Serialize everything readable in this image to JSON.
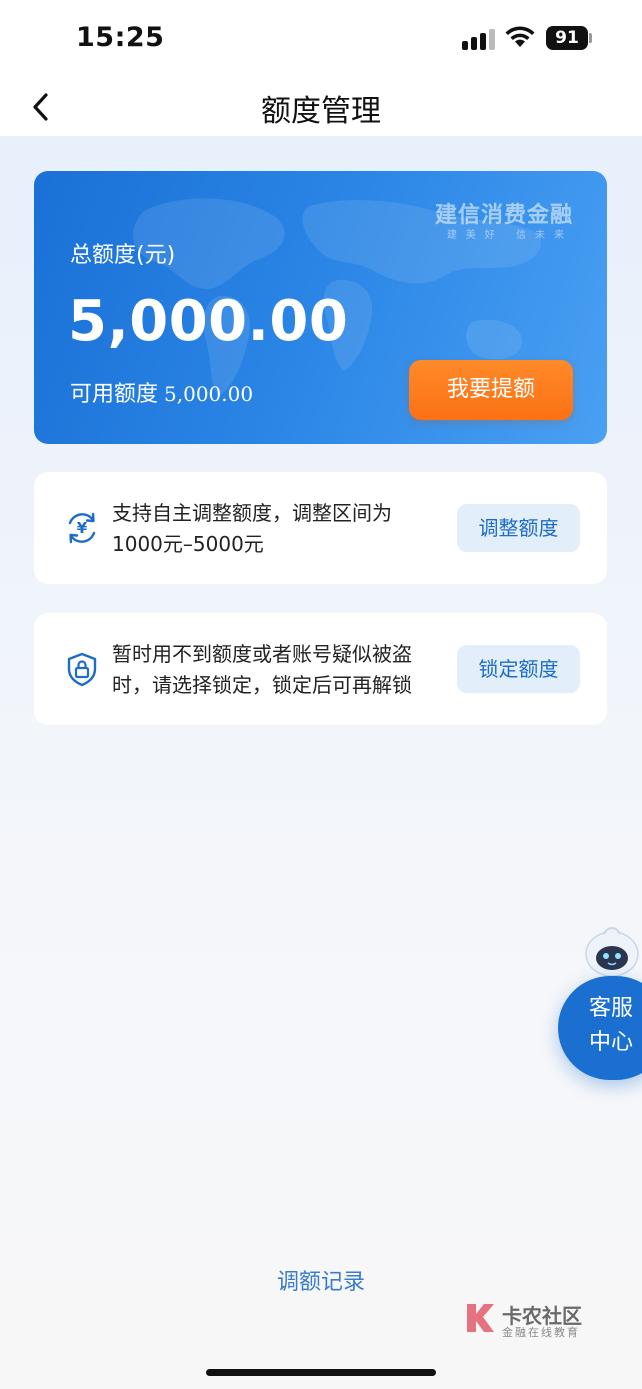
{
  "status_bar": {
    "time": "15:25",
    "battery": "91"
  },
  "nav": {
    "title": "额度管理",
    "back_icon": "chevron-left-icon"
  },
  "limit_card": {
    "brand": "建信消费金融",
    "brand_sub": "建美好 信未来",
    "total_label": "总额度(元)",
    "total_amount": "5,000.00",
    "available_label": "可用额度",
    "available_amount": "5,000.00",
    "raise_button": "我要提额",
    "accent": "#2b86e6",
    "button_color": "#fb7114"
  },
  "adjust_panel": {
    "icon": "yuan-cycle-icon",
    "text": "支持自主调整额度，调整区间为1000元–5000元",
    "button": "调整额度"
  },
  "lock_panel": {
    "icon": "shield-lock-icon",
    "text": "暂时用不到额度或者账号疑似被盗时，请选择锁定，锁定后可再解锁",
    "button": "锁定额度"
  },
  "customer_service": {
    "label": "客服中心",
    "icon": "mascot-icon"
  },
  "footer": {
    "records_link": "调额记录"
  },
  "watermark": {
    "title": "卡农社区",
    "subtitle": "金融在线教育"
  }
}
